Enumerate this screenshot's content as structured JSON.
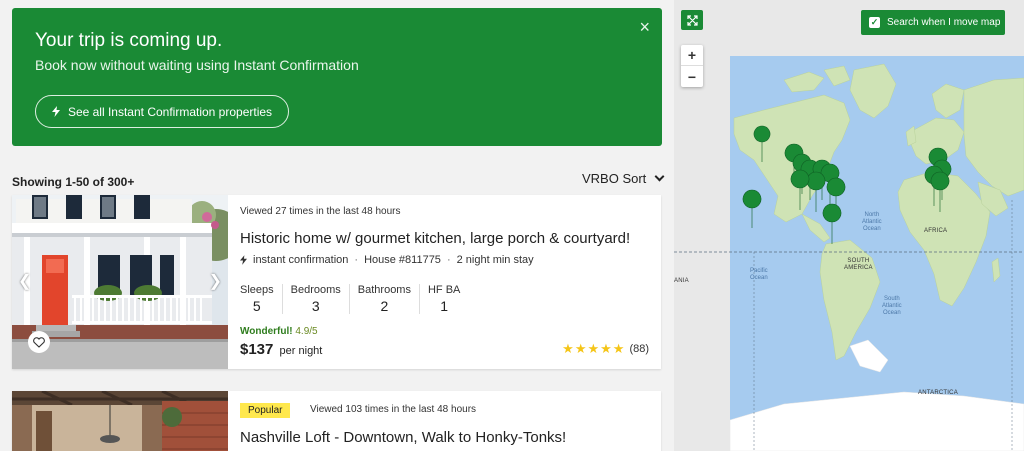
{
  "banner": {
    "title": "Your trip is coming up.",
    "subtitle": "Book now without waiting using Instant Confirmation",
    "button_label": "See all Instant Confirmation properties",
    "close_icon": "×"
  },
  "results": {
    "count_label": "Showing 1-50 of 300+",
    "sort_label": "VRBO Sort"
  },
  "listings": [
    {
      "viewed": "Viewed 27 times in the last 48 hours",
      "title": "Historic home w/ gourmet kitchen, large porch & courtyard!",
      "instant": "instant confirmation",
      "house": "House #811775",
      "min_stay": "2 night min stay",
      "stats": [
        {
          "label": "Sleeps",
          "value": "5"
        },
        {
          "label": "Bedrooms",
          "value": "3"
        },
        {
          "label": "Bathrooms",
          "value": "2"
        },
        {
          "label": "HF BA",
          "value": "1"
        }
      ],
      "rating_word": "Wonderful!",
      "rating_score": "4.9/5",
      "price": "$137",
      "price_unit": "per night",
      "stars": 5,
      "reviews": "(88)"
    },
    {
      "badge": "Popular",
      "viewed": "Viewed 103 times in the last 48 hours",
      "title": "Nashville Loft - Downtown, Walk to Honky-Tonks!"
    }
  ],
  "map": {
    "search_move_label": "Search when I move map",
    "search_move_checked": true,
    "zoom_in": "+",
    "zoom_out": "−",
    "labels": {
      "north_atlantic": "North\nAtlantic\nOcean",
      "africa": "AFRICA",
      "south_america": "SOUTH\nAMERICA",
      "pacific": "Pacific\nOcean",
      "south_atlantic": "South\nAtlantic\nOcean",
      "antarctica": "ANTARCTICA",
      "asia_edge": "ANIA"
    },
    "colors": {
      "water": "#a6cbef",
      "land": "#cfe3b5",
      "marker": "#1a8a35"
    }
  },
  "colors": {
    "brand": "#1a8a35",
    "badge": "#ffe84d",
    "star": "#f5c518"
  }
}
